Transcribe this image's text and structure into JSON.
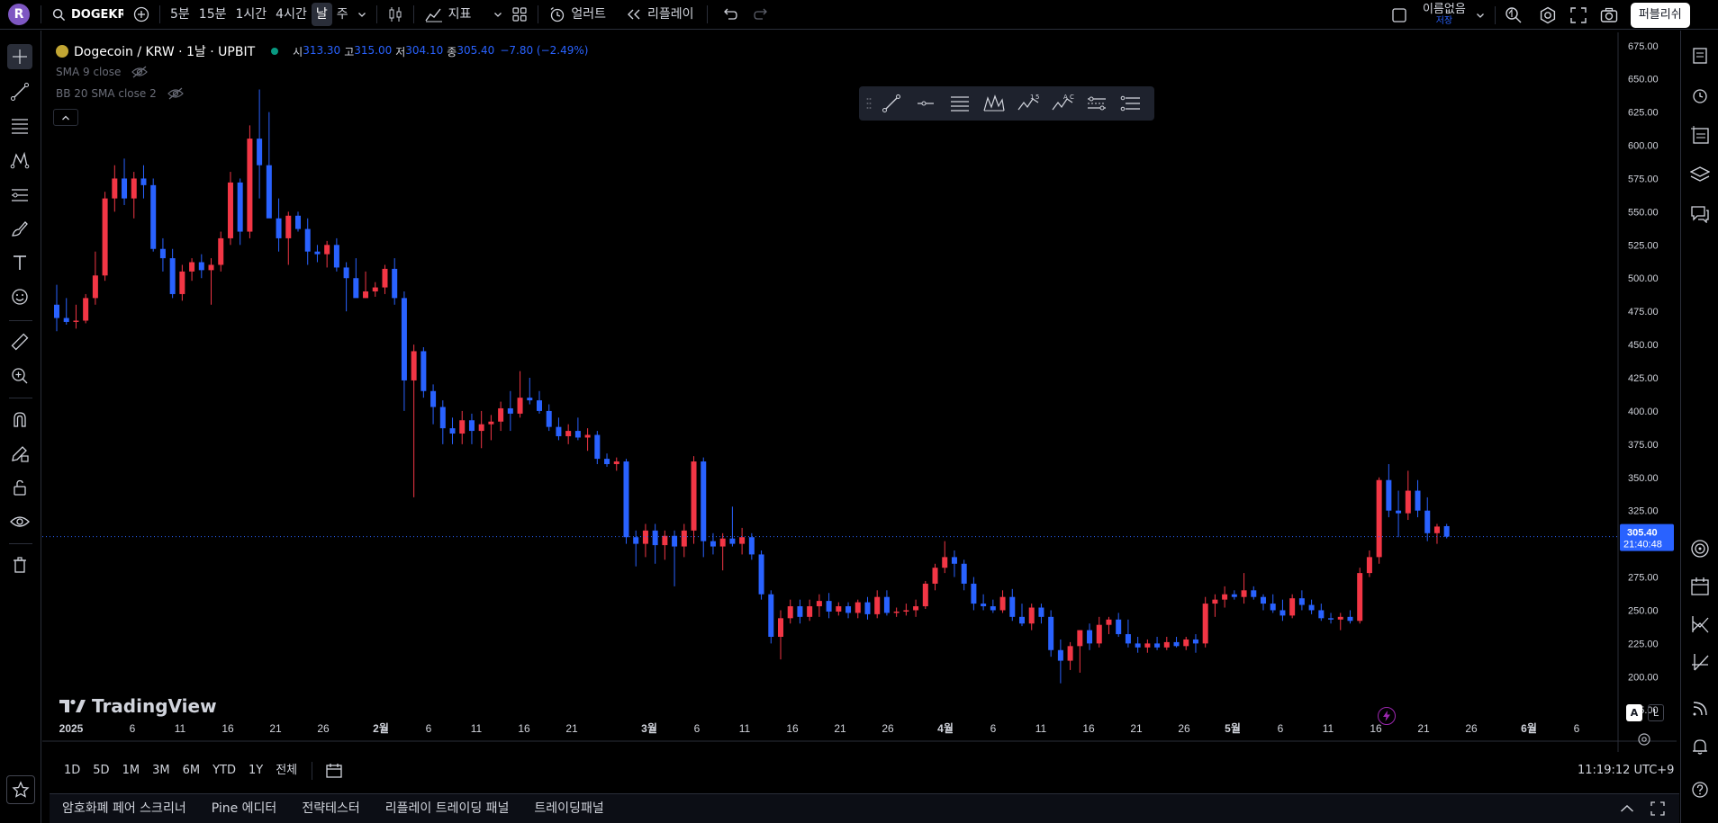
{
  "top": {
    "avatar_letter": "R",
    "symbol": "DOGEKRW",
    "intervals": [
      "5분",
      "15분",
      "1시간",
      "4시간",
      "날",
      "주"
    ],
    "active_interval": "날",
    "indicators_label": "지표",
    "alert_label": "얼러트",
    "replay_label": "리플레이",
    "layout_name": "이름없음",
    "save_label": "저장",
    "publish_label": "퍼블리쉬"
  },
  "legend": {
    "title": "Dogecoin / KRW · 1날 · UPBIT",
    "open_label": "시",
    "open": "313.30",
    "high_label": "고",
    "high": "315.00",
    "low_label": "저",
    "low": "304.10",
    "close_label": "종",
    "close": "305.40",
    "change": "−7.80 (−2.49%)",
    "sma": "SMA 9 close",
    "bb": "BB 20 SMA close 2"
  },
  "price_axis": {
    "ticks": [
      "675.00",
      "650.00",
      "625.00",
      "600.00",
      "575.00",
      "550.00",
      "525.00",
      "500.00",
      "475.00",
      "450.00",
      "425.00",
      "400.00",
      "375.00",
      "350.00",
      "325.00",
      "300.00",
      "275.00",
      "250.00",
      "225.00",
      "200.00",
      "175.00"
    ],
    "last_price": "305.40",
    "countdown": "21:40:48"
  },
  "time_axis": {
    "labels": [
      "2025",
      "6",
      "11",
      "16",
      "21",
      "26",
      "2월",
      "6",
      "11",
      "16",
      "21",
      "3월",
      "6",
      "11",
      "16",
      "21",
      "26",
      "4월",
      "6",
      "11",
      "16",
      "21",
      "26",
      "5월",
      "6",
      "11",
      "16",
      "21",
      "26",
      "6월",
      "6"
    ]
  },
  "watermark": "TradingView",
  "scale_buttons": [
    "A",
    "L"
  ],
  "ranges": [
    "1D",
    "5D",
    "1M",
    "3M",
    "6M",
    "YTD",
    "1Y",
    "전체"
  ],
  "clock": "11:19:12 UTC+9",
  "bottom_tabs": [
    "암호화폐 페어 스크리너",
    "Pine 에디터",
    "전략테스터",
    "리플레이 트레이딩 패널",
    "트레이딩패널"
  ],
  "colors": {
    "up": "#f23645",
    "down": "#2962ff",
    "accent": "#2962ff",
    "bg": "#000000"
  },
  "chart_data": {
    "type": "candlestick",
    "x_labels": [
      "2025",
      "6",
      "11",
      "16",
      "21",
      "26",
      "2월",
      "6",
      "11",
      "16",
      "21",
      "3월",
      "6",
      "11",
      "16",
      "21",
      "26",
      "4월",
      "6",
      "11",
      "16",
      "21",
      "26",
      "5월",
      "6",
      "11",
      "16",
      "21",
      "26",
      "6월",
      "6"
    ],
    "ylim": [
      165,
      685
    ],
    "candles": [
      {
        "o": 480,
        "h": 495,
        "l": 460,
        "c": 470
      },
      {
        "o": 470,
        "h": 485,
        "l": 465,
        "c": 467
      },
      {
        "o": 467,
        "h": 480,
        "l": 462,
        "c": 468
      },
      {
        "o": 468,
        "h": 488,
        "l": 466,
        "c": 485
      },
      {
        "o": 485,
        "h": 520,
        "l": 480,
        "c": 502
      },
      {
        "o": 502,
        "h": 565,
        "l": 498,
        "c": 560
      },
      {
        "o": 560,
        "h": 585,
        "l": 550,
        "c": 575
      },
      {
        "o": 575,
        "h": 590,
        "l": 555,
        "c": 560
      },
      {
        "o": 560,
        "h": 580,
        "l": 545,
        "c": 575
      },
      {
        "o": 575,
        "h": 585,
        "l": 560,
        "c": 570
      },
      {
        "o": 570,
        "h": 575,
        "l": 520,
        "c": 522
      },
      {
        "o": 522,
        "h": 530,
        "l": 505,
        "c": 515
      },
      {
        "o": 515,
        "h": 522,
        "l": 485,
        "c": 488
      },
      {
        "o": 488,
        "h": 510,
        "l": 483,
        "c": 505
      },
      {
        "o": 505,
        "h": 515,
        "l": 498,
        "c": 512
      },
      {
        "o": 512,
        "h": 518,
        "l": 500,
        "c": 506
      },
      {
        "o": 506,
        "h": 515,
        "l": 480,
        "c": 510
      },
      {
        "o": 510,
        "h": 535,
        "l": 505,
        "c": 530
      },
      {
        "o": 530,
        "h": 580,
        "l": 525,
        "c": 572
      },
      {
        "o": 572,
        "h": 575,
        "l": 525,
        "c": 535
      },
      {
        "o": 535,
        "h": 615,
        "l": 530,
        "c": 605
      },
      {
        "o": 605,
        "h": 642,
        "l": 560,
        "c": 585
      },
      {
        "o": 585,
        "h": 625,
        "l": 578,
        "c": 545
      },
      {
        "o": 545,
        "h": 560,
        "l": 520,
        "c": 530
      },
      {
        "o": 530,
        "h": 550,
        "l": 510,
        "c": 547
      },
      {
        "o": 547,
        "h": 550,
        "l": 535,
        "c": 537
      },
      {
        "o": 537,
        "h": 545,
        "l": 510,
        "c": 520
      },
      {
        "o": 520,
        "h": 525,
        "l": 512,
        "c": 518
      },
      {
        "o": 518,
        "h": 528,
        "l": 508,
        "c": 525
      },
      {
        "o": 525,
        "h": 530,
        "l": 505,
        "c": 508
      },
      {
        "o": 508,
        "h": 512,
        "l": 475,
        "c": 500
      },
      {
        "o": 500,
        "h": 515,
        "l": 490,
        "c": 485
      },
      {
        "o": 485,
        "h": 505,
        "l": 485,
        "c": 490
      },
      {
        "o": 490,
        "h": 497,
        "l": 486,
        "c": 493
      },
      {
        "o": 493,
        "h": 510,
        "l": 488,
        "c": 507
      },
      {
        "o": 507,
        "h": 515,
        "l": 480,
        "c": 485
      },
      {
        "o": 485,
        "h": 490,
        "l": 400,
        "c": 423
      },
      {
        "o": 423,
        "h": 450,
        "l": 335,
        "c": 445
      },
      {
        "o": 445,
        "h": 448,
        "l": 410,
        "c": 415
      },
      {
        "o": 415,
        "h": 420,
        "l": 390,
        "c": 403
      },
      {
        "o": 403,
        "h": 408,
        "l": 375,
        "c": 387
      },
      {
        "o": 387,
        "h": 395,
        "l": 375,
        "c": 383
      },
      {
        "o": 383,
        "h": 400,
        "l": 375,
        "c": 393
      },
      {
        "o": 393,
        "h": 398,
        "l": 375,
        "c": 385
      },
      {
        "o": 385,
        "h": 400,
        "l": 372,
        "c": 390
      },
      {
        "o": 390,
        "h": 397,
        "l": 378,
        "c": 392
      },
      {
        "o": 392,
        "h": 407,
        "l": 385,
        "c": 402
      },
      {
        "o": 402,
        "h": 415,
        "l": 385,
        "c": 398
      },
      {
        "o": 398,
        "h": 430,
        "l": 395,
        "c": 410
      },
      {
        "o": 410,
        "h": 425,
        "l": 405,
        "c": 408
      },
      {
        "o": 408,
        "h": 415,
        "l": 398,
        "c": 400
      },
      {
        "o": 400,
        "h": 405,
        "l": 385,
        "c": 388
      },
      {
        "o": 388,
        "h": 395,
        "l": 378,
        "c": 381
      },
      {
        "o": 381,
        "h": 390,
        "l": 375,
        "c": 385
      },
      {
        "o": 385,
        "h": 395,
        "l": 378,
        "c": 380
      },
      {
        "o": 380,
        "h": 387,
        "l": 370,
        "c": 382
      },
      {
        "o": 382,
        "h": 385,
        "l": 360,
        "c": 364
      },
      {
        "o": 364,
        "h": 368,
        "l": 358,
        "c": 360
      },
      {
        "o": 360,
        "h": 365,
        "l": 355,
        "c": 362
      },
      {
        "o": 362,
        "h": 364,
        "l": 300,
        "c": 305
      },
      {
        "o": 305,
        "h": 310,
        "l": 283,
        "c": 300
      },
      {
        "o": 300,
        "h": 315,
        "l": 290,
        "c": 310
      },
      {
        "o": 310,
        "h": 315,
        "l": 285,
        "c": 299
      },
      {
        "o": 299,
        "h": 310,
        "l": 288,
        "c": 306
      },
      {
        "o": 306,
        "h": 310,
        "l": 268,
        "c": 298
      },
      {
        "o": 298,
        "h": 315,
        "l": 290,
        "c": 310
      },
      {
        "o": 310,
        "h": 366,
        "l": 300,
        "c": 362
      },
      {
        "o": 362,
        "h": 365,
        "l": 290,
        "c": 302
      },
      {
        "o": 302,
        "h": 308,
        "l": 292,
        "c": 298
      },
      {
        "o": 298,
        "h": 308,
        "l": 280,
        "c": 304
      },
      {
        "o": 304,
        "h": 328,
        "l": 298,
        "c": 300
      },
      {
        "o": 300,
        "h": 312,
        "l": 292,
        "c": 305
      },
      {
        "o": 305,
        "h": 308,
        "l": 288,
        "c": 292
      },
      {
        "o": 292,
        "h": 295,
        "l": 258,
        "c": 262
      },
      {
        "o": 262,
        "h": 265,
        "l": 225,
        "c": 230
      },
      {
        "o": 230,
        "h": 250,
        "l": 213,
        "c": 244
      },
      {
        "o": 244,
        "h": 258,
        "l": 240,
        "c": 253
      },
      {
        "o": 253,
        "h": 258,
        "l": 240,
        "c": 245
      },
      {
        "o": 245,
        "h": 258,
        "l": 242,
        "c": 253
      },
      {
        "o": 253,
        "h": 262,
        "l": 245,
        "c": 257
      },
      {
        "o": 257,
        "h": 263,
        "l": 244,
        "c": 249
      },
      {
        "o": 249,
        "h": 256,
        "l": 246,
        "c": 253
      },
      {
        "o": 253,
        "h": 256,
        "l": 244,
        "c": 248
      },
      {
        "o": 248,
        "h": 258,
        "l": 244,
        "c": 256
      },
      {
        "o": 256,
        "h": 260,
        "l": 243,
        "c": 247
      },
      {
        "o": 247,
        "h": 265,
        "l": 244,
        "c": 260
      },
      {
        "o": 260,
        "h": 265,
        "l": 246,
        "c": 248
      },
      {
        "o": 248,
        "h": 252,
        "l": 245,
        "c": 249
      },
      {
        "o": 249,
        "h": 255,
        "l": 246,
        "c": 250
      },
      {
        "o": 250,
        "h": 258,
        "l": 245,
        "c": 253
      },
      {
        "o": 253,
        "h": 272,
        "l": 251,
        "c": 270
      },
      {
        "o": 270,
        "h": 285,
        "l": 265,
        "c": 282
      },
      {
        "o": 282,
        "h": 302,
        "l": 278,
        "c": 290
      },
      {
        "o": 290,
        "h": 295,
        "l": 275,
        "c": 285
      },
      {
        "o": 285,
        "h": 288,
        "l": 265,
        "c": 270
      },
      {
        "o": 270,
        "h": 275,
        "l": 250,
        "c": 255
      },
      {
        "o": 255,
        "h": 262,
        "l": 250,
        "c": 253
      },
      {
        "o": 253,
        "h": 258,
        "l": 248,
        "c": 250
      },
      {
        "o": 250,
        "h": 265,
        "l": 248,
        "c": 260
      },
      {
        "o": 260,
        "h": 266,
        "l": 242,
        "c": 245
      },
      {
        "o": 245,
        "h": 255,
        "l": 238,
        "c": 240
      },
      {
        "o": 240,
        "h": 255,
        "l": 235,
        "c": 252
      },
      {
        "o": 252,
        "h": 255,
        "l": 240,
        "c": 245
      },
      {
        "o": 245,
        "h": 250,
        "l": 215,
        "c": 220
      },
      {
        "o": 220,
        "h": 228,
        "l": 195,
        "c": 212
      },
      {
        "o": 212,
        "h": 226,
        "l": 205,
        "c": 223
      },
      {
        "o": 223,
        "h": 235,
        "l": 203,
        "c": 235
      },
      {
        "o": 235,
        "h": 240,
        "l": 220,
        "c": 225
      },
      {
        "o": 225,
        "h": 245,
        "l": 222,
        "c": 239
      },
      {
        "o": 239,
        "h": 245,
        "l": 232,
        "c": 243
      },
      {
        "o": 243,
        "h": 248,
        "l": 230,
        "c": 232
      },
      {
        "o": 232,
        "h": 243,
        "l": 222,
        "c": 225
      },
      {
        "o": 225,
        "h": 230,
        "l": 218,
        "c": 222
      },
      {
        "o": 222,
        "h": 228,
        "l": 218,
        "c": 225
      },
      {
        "o": 225,
        "h": 230,
        "l": 220,
        "c": 222
      },
      {
        "o": 222,
        "h": 230,
        "l": 220,
        "c": 226
      },
      {
        "o": 226,
        "h": 230,
        "l": 222,
        "c": 223
      },
      {
        "o": 223,
        "h": 230,
        "l": 220,
        "c": 228
      },
      {
        "o": 228,
        "h": 232,
        "l": 218,
        "c": 225
      },
      {
        "o": 225,
        "h": 260,
        "l": 222,
        "c": 255
      },
      {
        "o": 255,
        "h": 262,
        "l": 245,
        "c": 258
      },
      {
        "o": 258,
        "h": 268,
        "l": 252,
        "c": 262
      },
      {
        "o": 262,
        "h": 265,
        "l": 258,
        "c": 260
      },
      {
        "o": 260,
        "h": 278,
        "l": 255,
        "c": 265
      },
      {
        "o": 265,
        "h": 268,
        "l": 258,
        "c": 260
      },
      {
        "o": 260,
        "h": 262,
        "l": 250,
        "c": 255
      },
      {
        "o": 255,
        "h": 262,
        "l": 248,
        "c": 250
      },
      {
        "o": 250,
        "h": 258,
        "l": 242,
        "c": 246
      },
      {
        "o": 246,
        "h": 262,
        "l": 244,
        "c": 259
      },
      {
        "o": 259,
        "h": 265,
        "l": 250,
        "c": 254
      },
      {
        "o": 254,
        "h": 258,
        "l": 247,
        "c": 250
      },
      {
        "o": 250,
        "h": 255,
        "l": 242,
        "c": 244
      },
      {
        "o": 244,
        "h": 248,
        "l": 240,
        "c": 243
      },
      {
        "o": 243,
        "h": 248,
        "l": 235,
        "c": 245
      },
      {
        "o": 245,
        "h": 250,
        "l": 240,
        "c": 242
      },
      {
        "o": 242,
        "h": 282,
        "l": 240,
        "c": 278
      },
      {
        "o": 278,
        "h": 295,
        "l": 275,
        "c": 290
      },
      {
        "o": 290,
        "h": 350,
        "l": 285,
        "c": 348
      },
      {
        "o": 348,
        "h": 360,
        "l": 320,
        "c": 325
      },
      {
        "o": 325,
        "h": 340,
        "l": 305,
        "c": 323
      },
      {
        "o": 323,
        "h": 355,
        "l": 318,
        "c": 340
      },
      {
        "o": 340,
        "h": 348,
        "l": 320,
        "c": 325
      },
      {
        "o": 325,
        "h": 335,
        "l": 302,
        "c": 308
      },
      {
        "o": 308,
        "h": 315,
        "l": 300,
        "c": 313
      },
      {
        "o": 313.3,
        "h": 315,
        "l": 304.1,
        "c": 305.4
      }
    ]
  }
}
